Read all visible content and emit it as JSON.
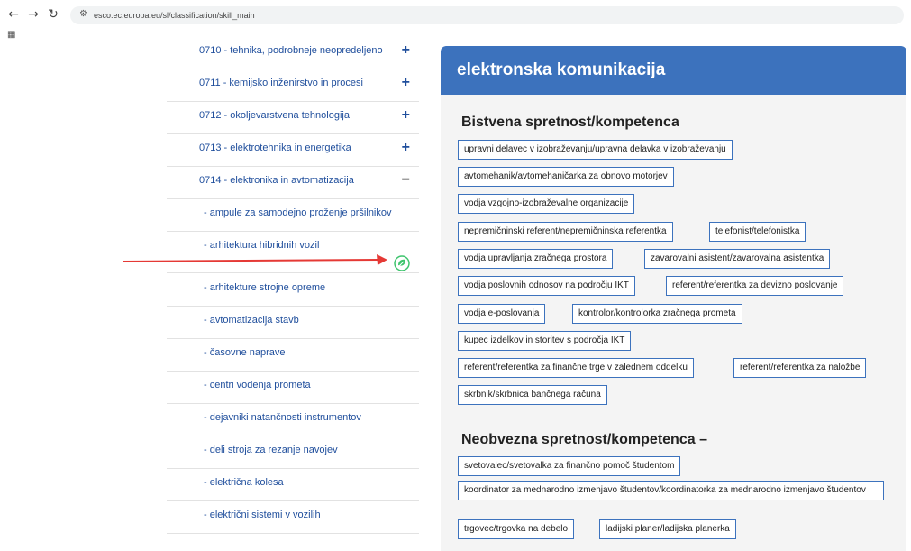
{
  "browser": {
    "back_icon": "arrow-left-icon",
    "forward_icon": "arrow-right-icon",
    "reload_icon": "reload-icon",
    "url": "esco.ec.europa.eu/sl/classification/skill_main"
  },
  "tree": {
    "items": [
      {
        "label": "0710 - tehnika, podrobneje neopredeljeno",
        "toggle": "+"
      },
      {
        "label": "0711 - kemijsko inženirstvo in procesi",
        "toggle": "+"
      },
      {
        "label": "0712 - okoljevarstvena tehnologija",
        "toggle": "+"
      },
      {
        "label": "0713 - elektrotehnika in energetika",
        "toggle": "+"
      },
      {
        "label": "0714 - elektronika in avtomatizacija",
        "toggle": "−"
      }
    ],
    "children": [
      {
        "label": "- ampule za samodejno proženje pršilnikov"
      },
      {
        "label": "- arhitektura hibridnih vozil"
      },
      {
        "label": "- arhitekture strojne opreme"
      },
      {
        "label": "- avtomatizacija stavb"
      },
      {
        "label": "- časovne naprave"
      },
      {
        "label": "- centri vodenja prometa"
      },
      {
        "label": "- dejavniki natančnosti instrumentov"
      },
      {
        "label": "- deli stroja za rezanje navojev"
      },
      {
        "label": "- električna kolesa"
      },
      {
        "label": "- električni sistemi v vozilih"
      }
    ]
  },
  "annotation": {
    "arrow_color": "#e53935",
    "icon_color": "#3ec46d",
    "icon_name": "tree-leaf-icon"
  },
  "panel": {
    "title": "elektronska komunikacija",
    "header_color": "#3c72bd",
    "essential_title": "Bistvena spretnost/kompetenca",
    "essential": [
      "upravni delavec v izobraževanju/upravna delavka v izobraževanju",
      "avtomehanik/avtomehaničarka za obnovo motorjev",
      "vodja vzgojno-izobraževalne organizacije",
      "nepremičninski referent/nepremičninska referentka",
      "telefonist/telefonistka",
      "vodja upravljanja zračnega prostora",
      "zavarovalni asistent/zavarovalna asistentka",
      "vodja poslovnih odnosov na področju IKT",
      "referent/referentka za devizno poslovanje",
      "vodja e-poslovanja",
      "kontrolor/kontrolorka zračnega prometa",
      "kupec izdelkov in storitev s področja IKT",
      "referent/referentka za finančne trge v zalednem oddelku",
      "referent/referentka za naložbe",
      "skrbnik/skrbnica bančnega računa"
    ],
    "optional_title": "Neobvezna spretnost/kompetenca –",
    "optional": [
      "svetovalec/svetovalka za finančno pomoč študentom",
      "koordinator za mednarodno izmenjavo študentov/koordinatorka za mednarodno izmenjavo študentov",
      "trgovec/trgovka na debelo",
      "ladijski planer/ladijska planerka"
    ]
  }
}
